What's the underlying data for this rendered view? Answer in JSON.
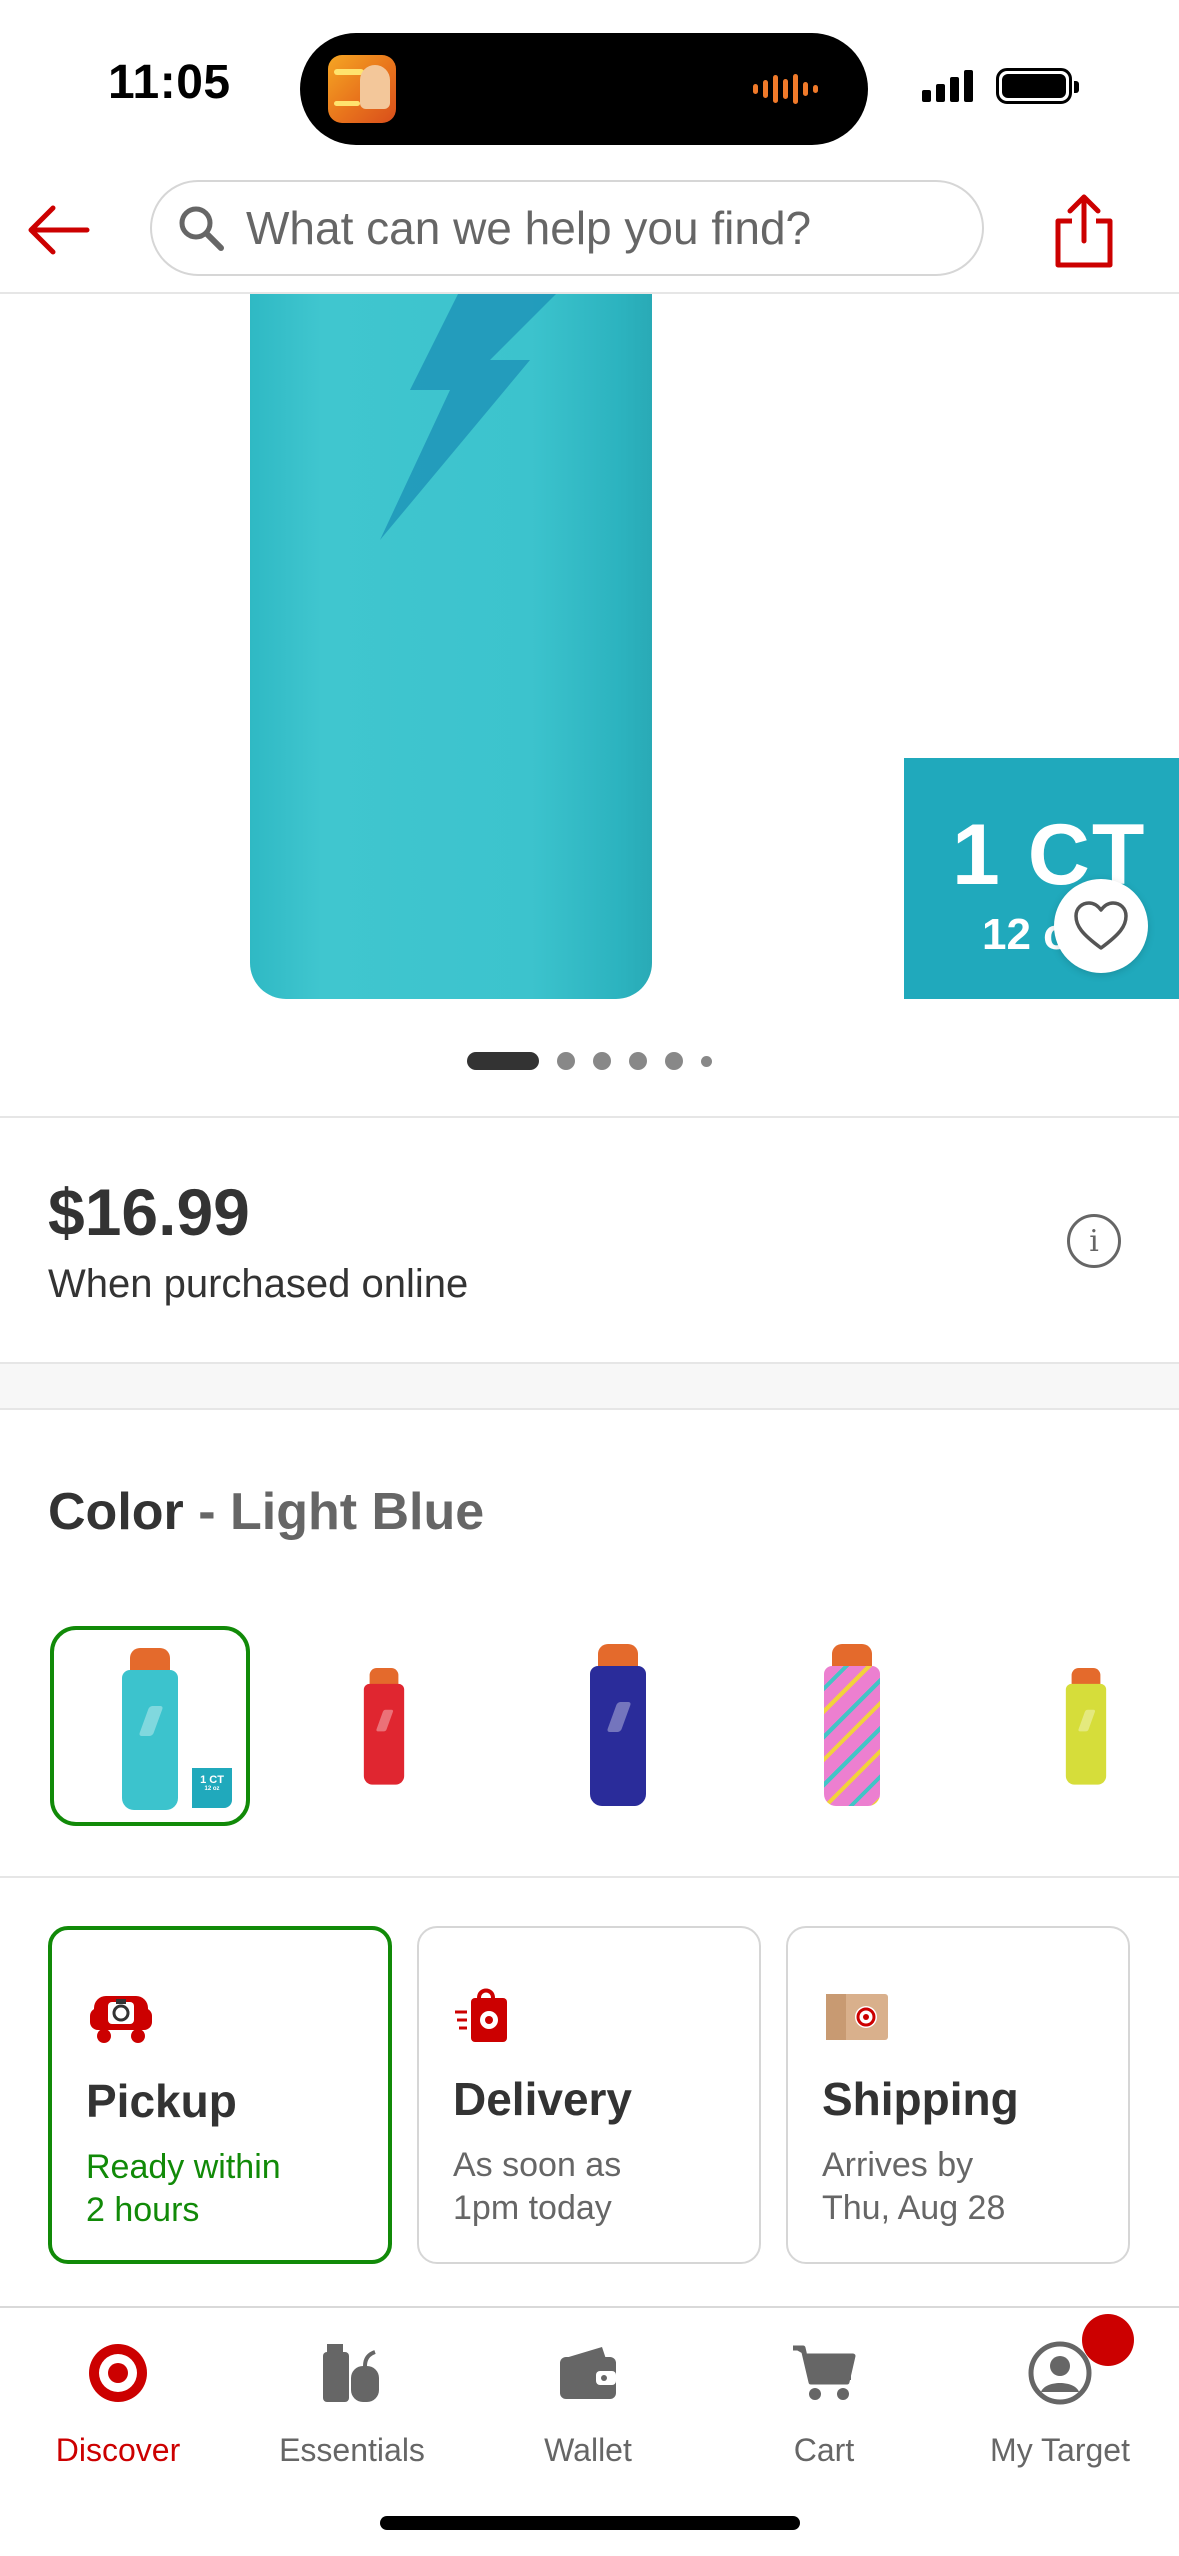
{
  "status_bar": {
    "time": "11:05"
  },
  "header": {
    "search_placeholder": "What can we help you find?"
  },
  "product": {
    "badge_count": "1 CT",
    "badge_size": "12 oz",
    "image_count": 6,
    "active_image_index": 0,
    "price": "$16.99",
    "price_note": "When purchased online",
    "info_glyph": "i"
  },
  "color": {
    "label": "Color",
    "separator": " - ",
    "selected_value": "Light Blue",
    "swatches": [
      {
        "name": "Light Blue",
        "body_color": "#3cc3cd",
        "selected": true
      },
      {
        "name": "Red",
        "body_color": "#e02630",
        "selected": false
      },
      {
        "name": "Blue",
        "body_color": "#2a2c9a",
        "selected": false
      },
      {
        "name": "Pink",
        "body_color": "#ec7fd0",
        "selected": false
      },
      {
        "name": "Yellow",
        "body_color": "#d6dd3a",
        "selected": false
      }
    ]
  },
  "fulfillment": {
    "pickup": {
      "title": "Pickup",
      "line1": "Ready within",
      "line2": "2 hours",
      "selected": true
    },
    "delivery": {
      "title": "Delivery",
      "line1": "As soon as",
      "line2": "1pm today",
      "selected": false
    },
    "shipping": {
      "title": "Shipping",
      "line1": "Arrives by",
      "line2": "Thu, Aug 28",
      "selected": false
    }
  },
  "bottom_nav": [
    {
      "label": "Discover",
      "icon": "target-logo-icon",
      "active": true
    },
    {
      "label": "Essentials",
      "icon": "essentials-icon",
      "active": false
    },
    {
      "label": "Wallet",
      "icon": "wallet-icon",
      "active": false
    },
    {
      "label": "Cart",
      "icon": "cart-icon",
      "active": false
    },
    {
      "label": "My Target",
      "icon": "account-icon",
      "active": false
    }
  ],
  "colors": {
    "brand_red": "#cc0000",
    "selected_green": "#118a08",
    "text_dark": "#333333",
    "text_muted": "#666666"
  }
}
